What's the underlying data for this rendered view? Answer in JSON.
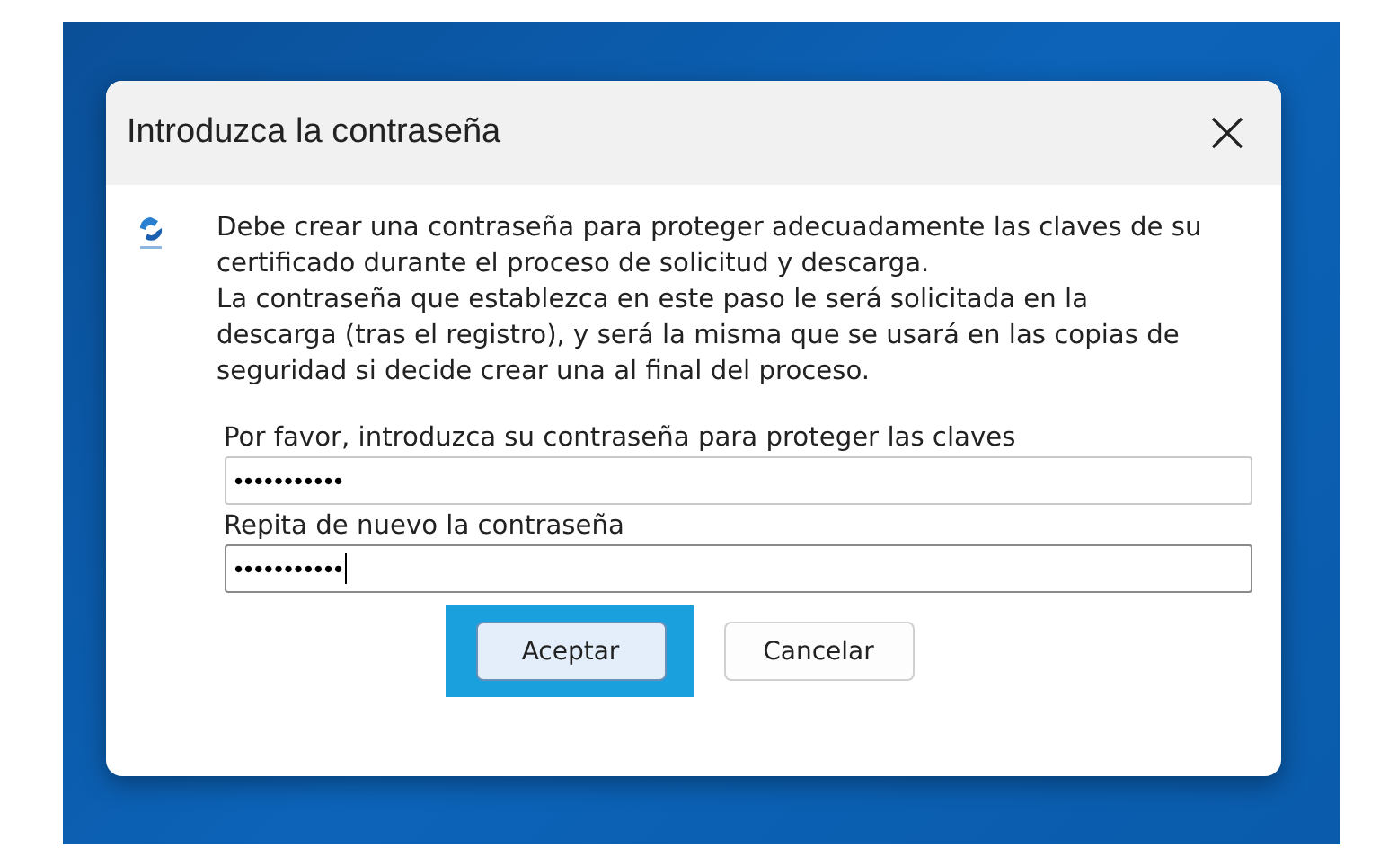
{
  "dialog": {
    "title": "Introduzca la contraseña",
    "message_lines": [
      "Debe crear una contraseña para proteger adecuadamente las claves de su",
      "certificado durante el proceso de solicitud y descarga.",
      "La contraseña que establezca en este paso le será solicitada en la",
      "descarga (tras el registro), y será la misma que se usará en las copias de",
      "seguridad si decide crear una al final del proceso."
    ],
    "fields": [
      {
        "label": "Por favor, introduzca su contraseña para proteger las claves",
        "value": "•••••••••••",
        "focused": false
      },
      {
        "label": "Repita de nuevo la contraseña",
        "value": "•••••••••••",
        "focused": true
      }
    ],
    "buttons": [
      {
        "label": "Aceptar",
        "default": true,
        "highlighted": true
      },
      {
        "label": "Cancelar",
        "default": false,
        "highlighted": false
      }
    ]
  }
}
